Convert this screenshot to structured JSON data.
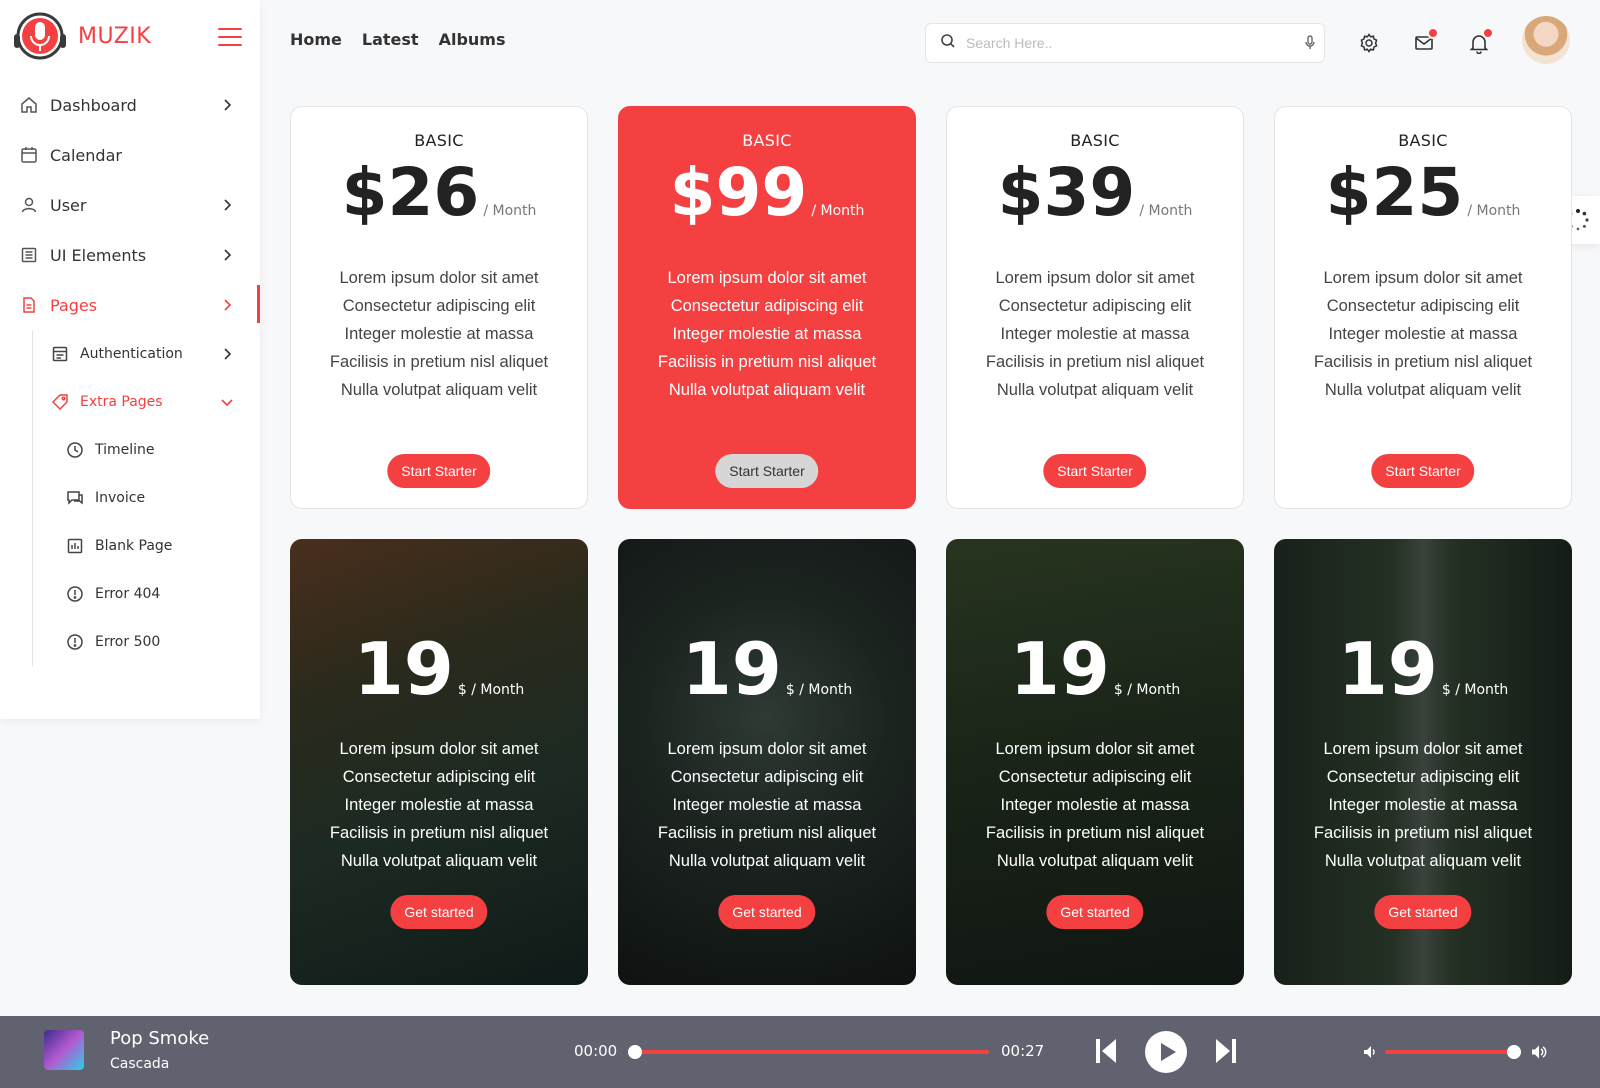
{
  "brand": {
    "name": "MUZIK"
  },
  "topnav": [
    "Home",
    "Latest",
    "Albums"
  ],
  "search": {
    "placeholder": "Search Here.."
  },
  "sidebar": {
    "items": [
      {
        "label": "Dashboard",
        "icon": "home-icon"
      },
      {
        "label": "Calendar",
        "icon": "calendar-icon"
      },
      {
        "label": "User",
        "icon": "user-icon"
      },
      {
        "label": "UI Elements",
        "icon": "layout-icon"
      },
      {
        "label": "Pages",
        "icon": "file-icon"
      }
    ],
    "sub": [
      {
        "label": "Authentication",
        "icon": "layout-icon"
      },
      {
        "label": "Extra Pages",
        "icon": "tag-icon"
      }
    ],
    "extra": [
      {
        "label": "Timeline",
        "icon": "clock-icon"
      },
      {
        "label": "Invoice",
        "icon": "chat-icon"
      },
      {
        "label": "Blank Page",
        "icon": "chart-icon"
      },
      {
        "label": "Error 404",
        "icon": "alert-icon"
      },
      {
        "label": "Error 500",
        "icon": "alert-icon"
      }
    ]
  },
  "plans": [
    {
      "name": "BASIC",
      "price": "$26",
      "period": "/ Month",
      "button": "Start Starter",
      "featured": false
    },
    {
      "name": "BASIC",
      "price": "$99",
      "period": "/ Month",
      "button": "Start Starter",
      "featured": true
    },
    {
      "name": "BASIC",
      "price": "$39",
      "period": "/ Month",
      "button": "Start Starter",
      "featured": false
    },
    {
      "name": "BASIC",
      "price": "$25",
      "period": "/ Month",
      "button": "Start Starter",
      "featured": false
    }
  ],
  "features": [
    "Lorem ipsum dolor sit amet",
    "Consectetur adipiscing elit",
    "Integer molestie at massa",
    "Facilisis in pretium nisl aliquet",
    "Nulla volutpat aliquam velit"
  ],
  "photo_plans": [
    {
      "price": "19",
      "unit": "$ / Month",
      "button": "Get started"
    },
    {
      "price": "19",
      "unit": "$ / Month",
      "button": "Get started"
    },
    {
      "price": "19",
      "unit": "$ / Month",
      "button": "Get started"
    },
    {
      "price": "19",
      "unit": "$ / Month",
      "button": "Get started"
    }
  ],
  "player": {
    "title": "Pop Smoke",
    "artist": "Cascada",
    "current_time": "00:00",
    "duration": "00:27",
    "progress": 0,
    "volume": 1.0
  },
  "colors": {
    "accent": "#f44040",
    "player_bg": "#60626f"
  }
}
